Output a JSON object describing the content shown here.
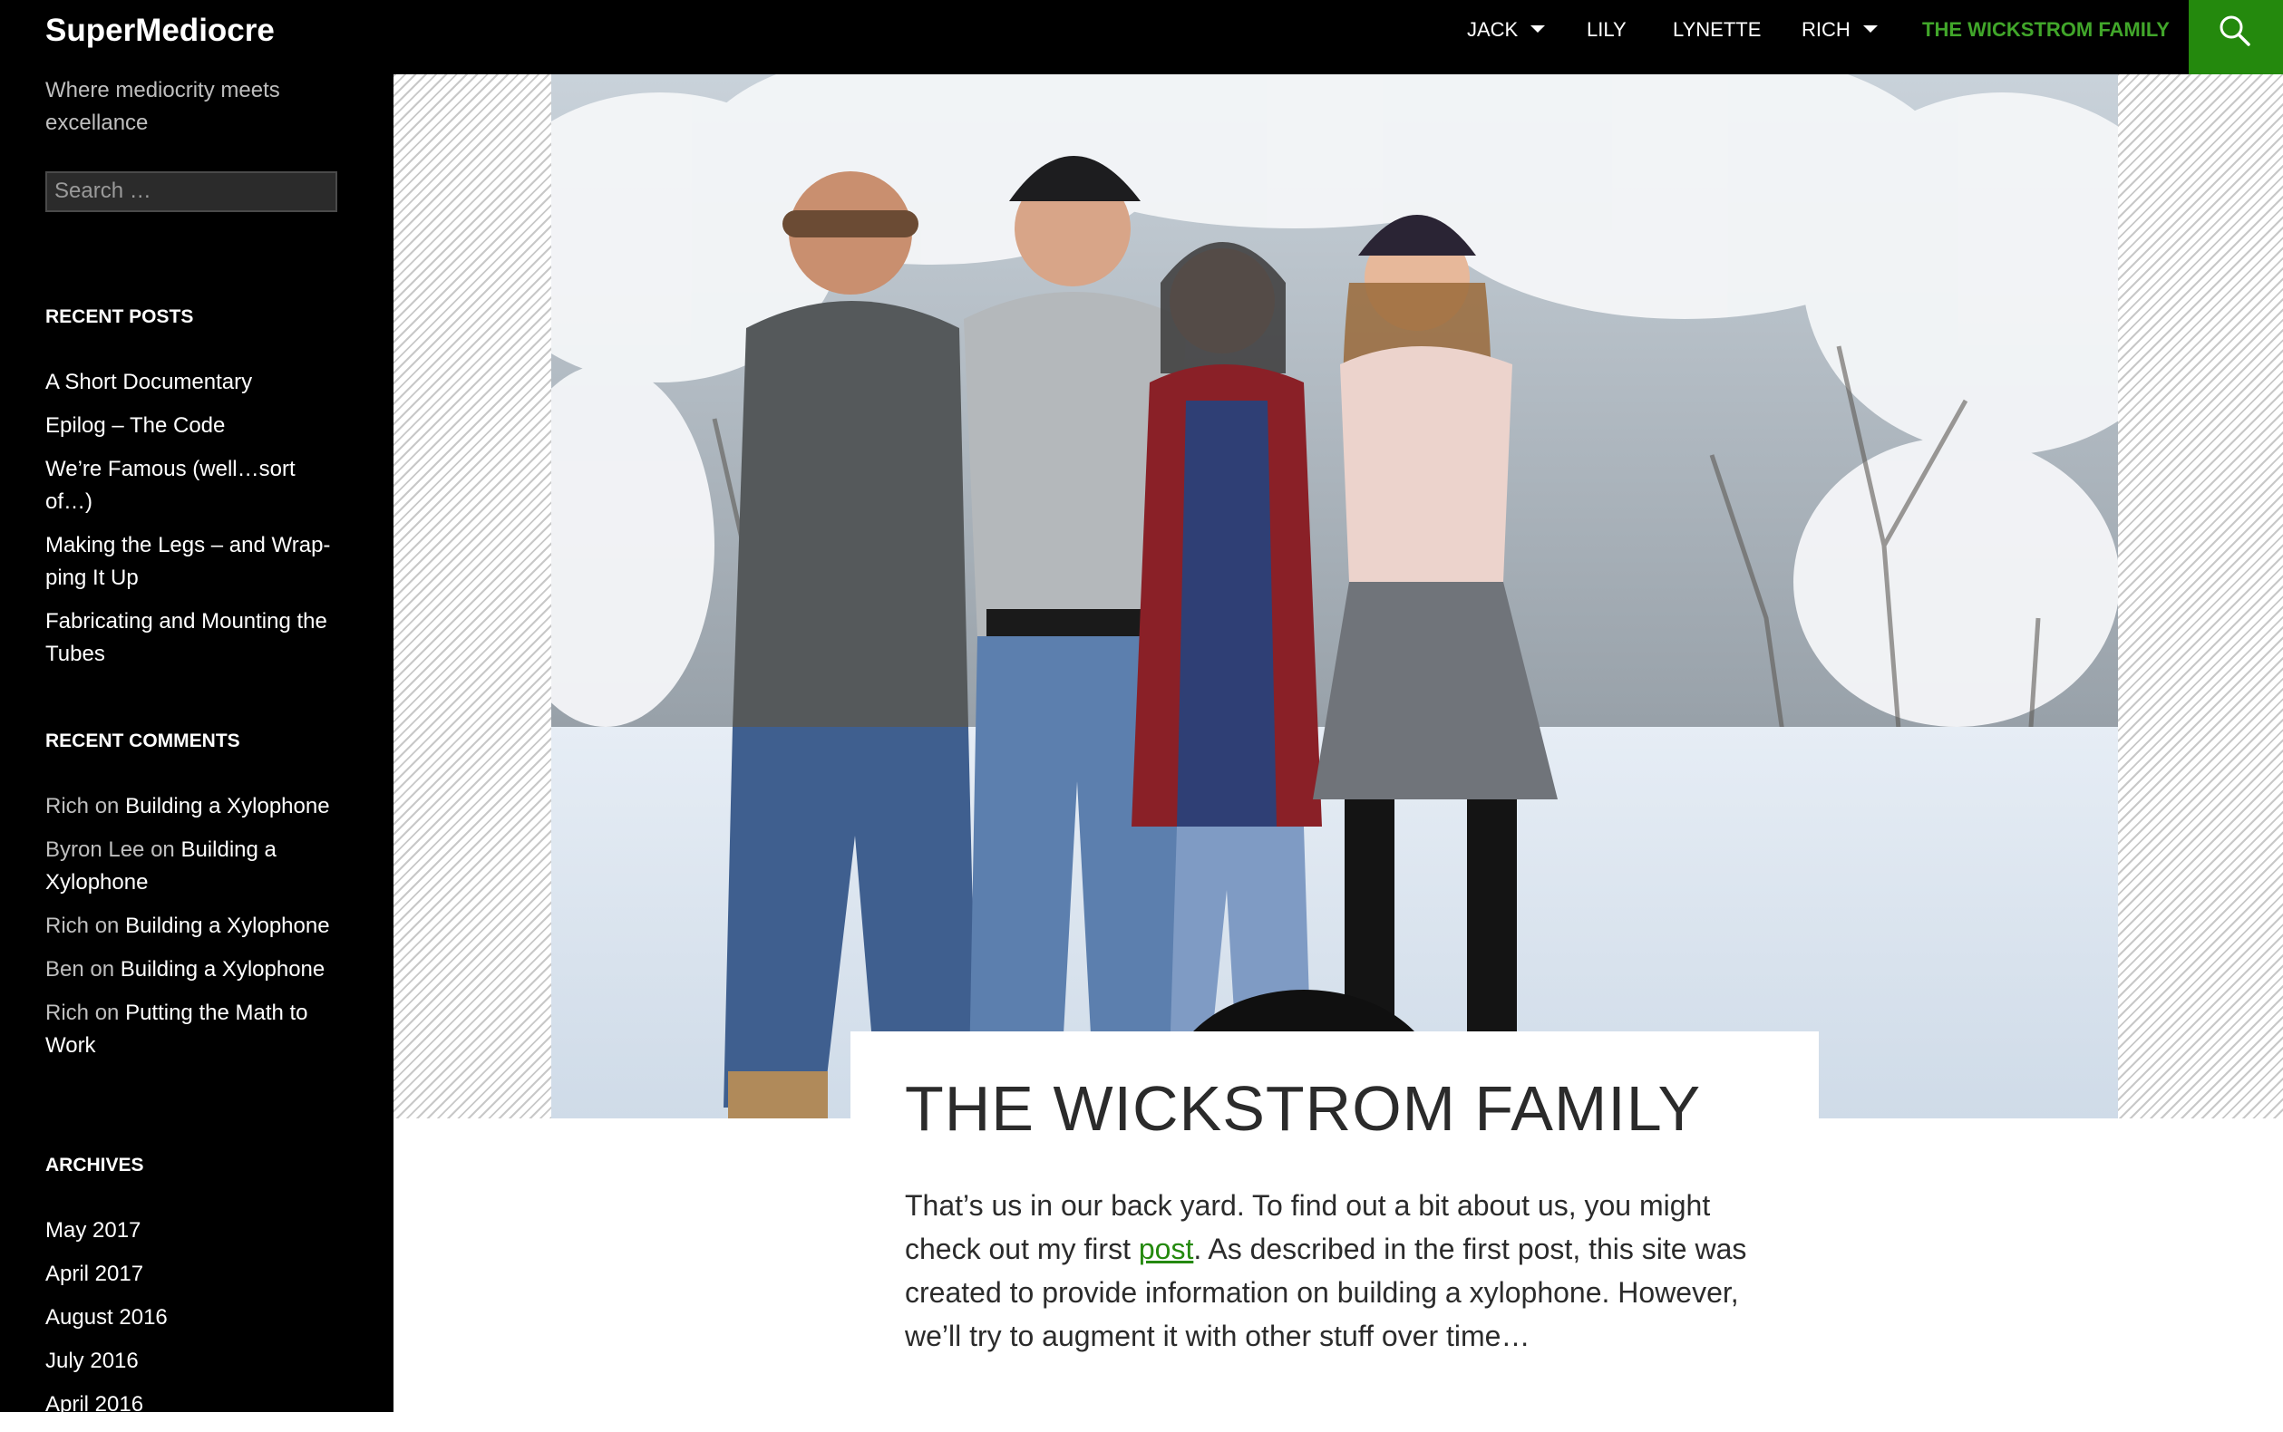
{
  "site": {
    "title": "SuperMediocre",
    "tagline": "Where mediocrity meets excellance",
    "search_placeholder": "Search …"
  },
  "nav": {
    "items": [
      {
        "label": "JACK",
        "has_submenu": true
      },
      {
        "label": "LILY",
        "has_submenu": false
      },
      {
        "label": "LYNETTE",
        "has_submenu": false
      },
      {
        "label": "RICH",
        "has_submenu": true
      },
      {
        "label": "THE WICKSTROM FAMILY",
        "has_submenu": false,
        "active": true
      }
    ],
    "search_icon": "search-icon",
    "accent_color": "#24890d"
  },
  "sidebar": {
    "recent_posts": {
      "title": "RECENT POSTS",
      "items": [
        "A Short Documentary",
        "Epilog – The Code",
        "We’re Famous (well…sort of…)",
        "Making the Legs – and Wrap­ping It Up",
        "Fabricating and Mounting the Tubes"
      ]
    },
    "recent_comments": {
      "title": "RECENT COMMENTS",
      "on": "on",
      "items": [
        {
          "author": "Rich",
          "post": "Building a Xylophone"
        },
        {
          "author": "Byron Lee",
          "post": "Building a Xylophone"
        },
        {
          "author": "Rich",
          "post": "Building a Xylophone"
        },
        {
          "author": "Ben",
          "post": "Building a Xylophone"
        },
        {
          "author": "Rich",
          "post": "Putting the Math to Work"
        }
      ]
    },
    "archives": {
      "title": "ARCHIVES",
      "items": [
        "May 2017",
        "April 2017",
        "August 2016",
        "July 2016",
        "April 2016"
      ]
    }
  },
  "article": {
    "title": "THE WICKSTROM FAMILY",
    "text_before_link": "That’s us in our back yard. To find out a bit about us, you might check out my first ",
    "link_text": "post",
    "text_after_link": ". As described in the first post, this site was created to provide information on building a xylophone. However, we’ll try to augment it with other stuff over time…"
  }
}
